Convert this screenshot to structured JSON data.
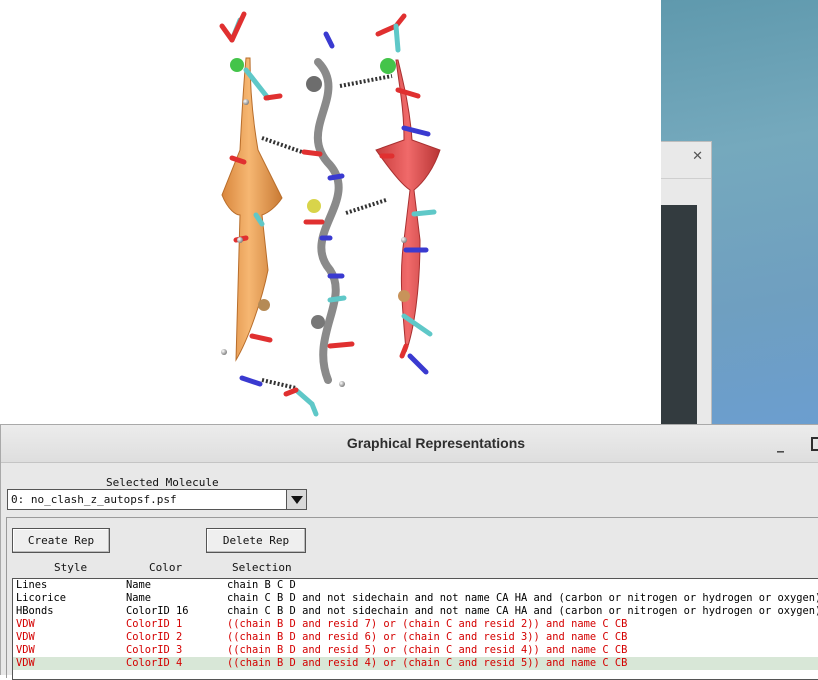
{
  "dialog": {
    "title": "Graphical Representations",
    "selected_molecule_label": "Selected Molecule",
    "selected_molecule": "0: no_clash_z_autopsf.psf",
    "create_rep_label": "Create Rep",
    "delete_rep_label": "Delete Rep",
    "columns": {
      "style": "Style",
      "color": "Color",
      "selection": "Selection"
    },
    "reps": [
      {
        "style": "Lines",
        "color": "Name",
        "selection": "chain B C D",
        "text_color": "#000000",
        "selected": false
      },
      {
        "style": "Licorice",
        "color": "Name",
        "selection": "chain C B D and not sidechain and not name CA HA and (carbon or nitrogen or hydrogen or oxygen)",
        "text_color": "#000000",
        "selected": false
      },
      {
        "style": "HBonds",
        "color": "ColorID 16",
        "selection": "chain C B D and not sidechain and not name CA HA and (carbon or nitrogen or hydrogen or oxygen)",
        "text_color": "#000000",
        "selected": false
      },
      {
        "style": "VDW",
        "color": "ColorID 1",
        "selection": "((chain B D and resid 7) or (chain C and resid 2)) and name C CB",
        "text_color": "#d40000",
        "selected": false
      },
      {
        "style": "VDW",
        "color": "ColorID 2",
        "selection": "((chain B D and resid 6) or (chain C and resid 3)) and name C CB",
        "text_color": "#d40000",
        "selected": false
      },
      {
        "style": "VDW",
        "color": "ColorID 3",
        "selection": "((chain B D and resid 5) or (chain C and resid 4)) and name C CB",
        "text_color": "#d40000",
        "selected": false
      },
      {
        "style": "VDW",
        "color": "ColorID 4",
        "selection": "((chain B D and resid 4) or (chain C and resid 5)) and name C CB",
        "text_color": "#d40000",
        "selected": true
      }
    ]
  },
  "colors": {
    "strand_left": "#f0a65e",
    "strand_right": "#e85a5a",
    "backbone": "#8a8a8a",
    "carbon": "#5fc8c8",
    "oxygen": "#e03030",
    "nitrogen": "#3a3ad0",
    "hydrogen": "#ffffff"
  }
}
